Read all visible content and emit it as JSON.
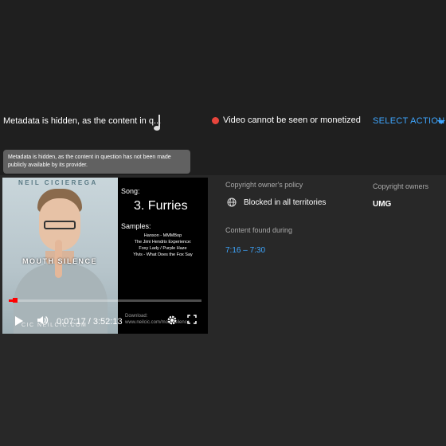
{
  "claim_row": {
    "metadata_text": "Metadata is hidden, as the content in q...",
    "status_text": "Video cannot be seen or monetized",
    "action_label": "SELECT ACTION",
    "status_color": "#e8453c",
    "accent_color": "#3ea6ff"
  },
  "tooltip": {
    "text": "Metadata is hidden, as the content in question has not been made publicly available by its provider."
  },
  "player": {
    "thumbnail": {
      "artist": "NEIL CICIEREGA",
      "title": "MOUTH SILENCE",
      "url": "CIC NEILCIC.COM"
    },
    "song_label": "Song:",
    "song_title": "3. Furries",
    "samples_label": "Samples:",
    "samples": [
      "Hanson - MMMBop",
      "The Jimi Hendrix Experience:",
      "Foxy Lady / Purple Haze",
      "Ylvis - What Does the Fox Say"
    ],
    "download_label": "Download:",
    "download_url": "www.neilcic.com/mouthsilence",
    "current_time": "0:07:17",
    "duration": "3:52:13",
    "time_display": "0:07:17 / 3:52:13",
    "progress_fraction": 0.031
  },
  "details": {
    "policy_label": "Copyright owner's policy",
    "policy_value": "Blocked in all territories",
    "found_label": "Content found during",
    "found_value": "7:16 – 7:30",
    "owners_label": "Copyright owners",
    "owners_value": "UMG"
  },
  "icons": {
    "music_note": "music-note-icon",
    "globe": "globe-icon",
    "play": "play-icon",
    "volume": "volume-icon",
    "settings": "gear-icon",
    "fullscreen": "fullscreen-icon"
  }
}
